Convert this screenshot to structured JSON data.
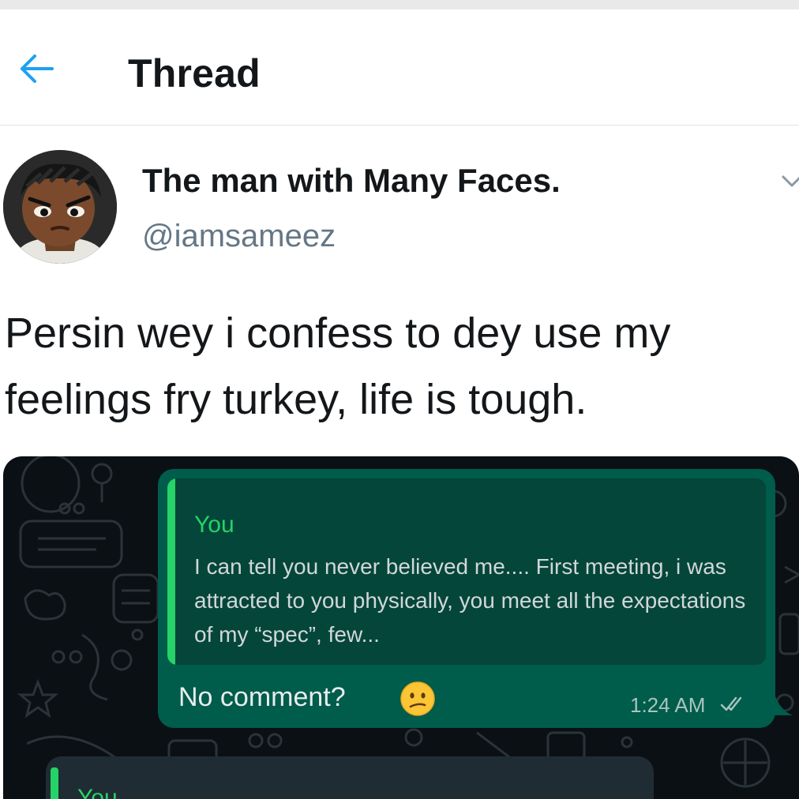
{
  "header": {
    "title": "Thread",
    "back_icon": "arrow-left-icon",
    "accent": "#1da1f2"
  },
  "tweet": {
    "display_name": "The man with Many Faces.",
    "handle": "@iamsameez",
    "text": "Persin wey i confess to dey use my feelings fry turkey, life is tough.",
    "caret_icon": "chevron-down-icon"
  },
  "chat": {
    "quote_author": "You",
    "quote_text": "I can tell you never believed me.... First meeting, i was attracted to you physically, you meet all the expectations of my “spec”, few...",
    "message": "No comment?",
    "emoji": "confused-face-emoji",
    "time": "1:24 AM",
    "status_icon": "double-check-icon",
    "second_quote_author": "You",
    "bubble_color": "#005c4b",
    "quote_color": "#25d366"
  }
}
